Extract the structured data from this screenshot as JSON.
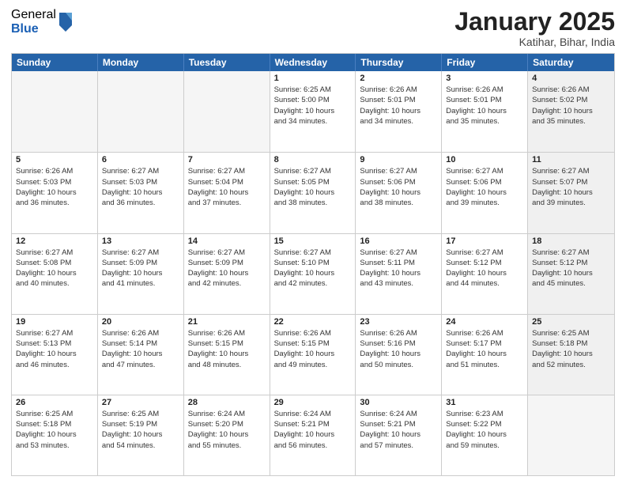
{
  "logo": {
    "general": "General",
    "blue": "Blue"
  },
  "title": "January 2025",
  "location": "Katihar, Bihar, India",
  "days": [
    "Sunday",
    "Monday",
    "Tuesday",
    "Wednesday",
    "Thursday",
    "Friday",
    "Saturday"
  ],
  "weeks": [
    [
      {
        "num": "",
        "lines": [],
        "empty": true
      },
      {
        "num": "",
        "lines": [],
        "empty": true
      },
      {
        "num": "",
        "lines": [],
        "empty": true
      },
      {
        "num": "1",
        "lines": [
          "Sunrise: 6:25 AM",
          "Sunset: 5:00 PM",
          "Daylight: 10 hours",
          "and 34 minutes."
        ],
        "empty": false
      },
      {
        "num": "2",
        "lines": [
          "Sunrise: 6:26 AM",
          "Sunset: 5:01 PM",
          "Daylight: 10 hours",
          "and 34 minutes."
        ],
        "empty": false
      },
      {
        "num": "3",
        "lines": [
          "Sunrise: 6:26 AM",
          "Sunset: 5:01 PM",
          "Daylight: 10 hours",
          "and 35 minutes."
        ],
        "empty": false
      },
      {
        "num": "4",
        "lines": [
          "Sunrise: 6:26 AM",
          "Sunset: 5:02 PM",
          "Daylight: 10 hours",
          "and 35 minutes."
        ],
        "empty": false,
        "shaded": true
      }
    ],
    [
      {
        "num": "5",
        "lines": [
          "Sunrise: 6:26 AM",
          "Sunset: 5:03 PM",
          "Daylight: 10 hours",
          "and 36 minutes."
        ],
        "empty": false
      },
      {
        "num": "6",
        "lines": [
          "Sunrise: 6:27 AM",
          "Sunset: 5:03 PM",
          "Daylight: 10 hours",
          "and 36 minutes."
        ],
        "empty": false
      },
      {
        "num": "7",
        "lines": [
          "Sunrise: 6:27 AM",
          "Sunset: 5:04 PM",
          "Daylight: 10 hours",
          "and 37 minutes."
        ],
        "empty": false
      },
      {
        "num": "8",
        "lines": [
          "Sunrise: 6:27 AM",
          "Sunset: 5:05 PM",
          "Daylight: 10 hours",
          "and 38 minutes."
        ],
        "empty": false
      },
      {
        "num": "9",
        "lines": [
          "Sunrise: 6:27 AM",
          "Sunset: 5:06 PM",
          "Daylight: 10 hours",
          "and 38 minutes."
        ],
        "empty": false
      },
      {
        "num": "10",
        "lines": [
          "Sunrise: 6:27 AM",
          "Sunset: 5:06 PM",
          "Daylight: 10 hours",
          "and 39 minutes."
        ],
        "empty": false
      },
      {
        "num": "11",
        "lines": [
          "Sunrise: 6:27 AM",
          "Sunset: 5:07 PM",
          "Daylight: 10 hours",
          "and 39 minutes."
        ],
        "empty": false,
        "shaded": true
      }
    ],
    [
      {
        "num": "12",
        "lines": [
          "Sunrise: 6:27 AM",
          "Sunset: 5:08 PM",
          "Daylight: 10 hours",
          "and 40 minutes."
        ],
        "empty": false
      },
      {
        "num": "13",
        "lines": [
          "Sunrise: 6:27 AM",
          "Sunset: 5:09 PM",
          "Daylight: 10 hours",
          "and 41 minutes."
        ],
        "empty": false
      },
      {
        "num": "14",
        "lines": [
          "Sunrise: 6:27 AM",
          "Sunset: 5:09 PM",
          "Daylight: 10 hours",
          "and 42 minutes."
        ],
        "empty": false
      },
      {
        "num": "15",
        "lines": [
          "Sunrise: 6:27 AM",
          "Sunset: 5:10 PM",
          "Daylight: 10 hours",
          "and 42 minutes."
        ],
        "empty": false
      },
      {
        "num": "16",
        "lines": [
          "Sunrise: 6:27 AM",
          "Sunset: 5:11 PM",
          "Daylight: 10 hours",
          "and 43 minutes."
        ],
        "empty": false
      },
      {
        "num": "17",
        "lines": [
          "Sunrise: 6:27 AM",
          "Sunset: 5:12 PM",
          "Daylight: 10 hours",
          "and 44 minutes."
        ],
        "empty": false
      },
      {
        "num": "18",
        "lines": [
          "Sunrise: 6:27 AM",
          "Sunset: 5:12 PM",
          "Daylight: 10 hours",
          "and 45 minutes."
        ],
        "empty": false,
        "shaded": true
      }
    ],
    [
      {
        "num": "19",
        "lines": [
          "Sunrise: 6:27 AM",
          "Sunset: 5:13 PM",
          "Daylight: 10 hours",
          "and 46 minutes."
        ],
        "empty": false
      },
      {
        "num": "20",
        "lines": [
          "Sunrise: 6:26 AM",
          "Sunset: 5:14 PM",
          "Daylight: 10 hours",
          "and 47 minutes."
        ],
        "empty": false
      },
      {
        "num": "21",
        "lines": [
          "Sunrise: 6:26 AM",
          "Sunset: 5:15 PM",
          "Daylight: 10 hours",
          "and 48 minutes."
        ],
        "empty": false
      },
      {
        "num": "22",
        "lines": [
          "Sunrise: 6:26 AM",
          "Sunset: 5:15 PM",
          "Daylight: 10 hours",
          "and 49 minutes."
        ],
        "empty": false
      },
      {
        "num": "23",
        "lines": [
          "Sunrise: 6:26 AM",
          "Sunset: 5:16 PM",
          "Daylight: 10 hours",
          "and 50 minutes."
        ],
        "empty": false
      },
      {
        "num": "24",
        "lines": [
          "Sunrise: 6:26 AM",
          "Sunset: 5:17 PM",
          "Daylight: 10 hours",
          "and 51 minutes."
        ],
        "empty": false
      },
      {
        "num": "25",
        "lines": [
          "Sunrise: 6:25 AM",
          "Sunset: 5:18 PM",
          "Daylight: 10 hours",
          "and 52 minutes."
        ],
        "empty": false,
        "shaded": true
      }
    ],
    [
      {
        "num": "26",
        "lines": [
          "Sunrise: 6:25 AM",
          "Sunset: 5:18 PM",
          "Daylight: 10 hours",
          "and 53 minutes."
        ],
        "empty": false
      },
      {
        "num": "27",
        "lines": [
          "Sunrise: 6:25 AM",
          "Sunset: 5:19 PM",
          "Daylight: 10 hours",
          "and 54 minutes."
        ],
        "empty": false
      },
      {
        "num": "28",
        "lines": [
          "Sunrise: 6:24 AM",
          "Sunset: 5:20 PM",
          "Daylight: 10 hours",
          "and 55 minutes."
        ],
        "empty": false
      },
      {
        "num": "29",
        "lines": [
          "Sunrise: 6:24 AM",
          "Sunset: 5:21 PM",
          "Daylight: 10 hours",
          "and 56 minutes."
        ],
        "empty": false
      },
      {
        "num": "30",
        "lines": [
          "Sunrise: 6:24 AM",
          "Sunset: 5:21 PM",
          "Daylight: 10 hours",
          "and 57 minutes."
        ],
        "empty": false
      },
      {
        "num": "31",
        "lines": [
          "Sunrise: 6:23 AM",
          "Sunset: 5:22 PM",
          "Daylight: 10 hours",
          "and 59 minutes."
        ],
        "empty": false
      },
      {
        "num": "",
        "lines": [],
        "empty": true,
        "shaded": true
      }
    ]
  ]
}
